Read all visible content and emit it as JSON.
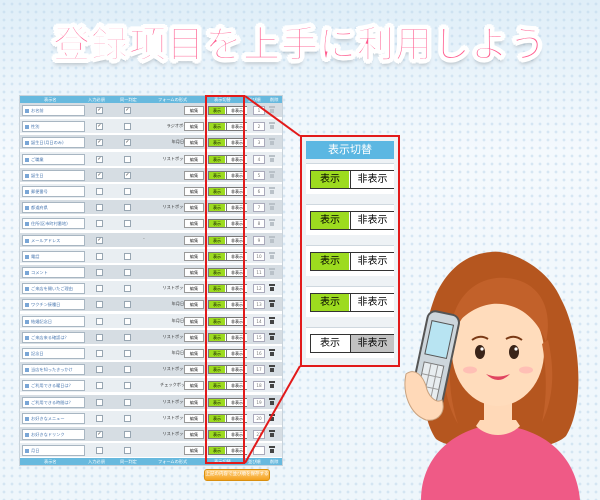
{
  "headline": "登録項目を上手に利用しよう",
  "table": {
    "header": [
      "表示名",
      "入力必須",
      "同一判定",
      "フォームの形式",
      "表示切替",
      "並び順",
      "削除"
    ],
    "footer": [
      "表示名",
      "入力必須",
      "同一判定",
      "フォームの形式",
      "表示切替",
      "並び順",
      "削除"
    ],
    "edit_label": "編集",
    "toggle_on": "表示",
    "toggle_off": "非表示",
    "rows": [
      {
        "name": "お名前",
        "required": true,
        "same": true,
        "type": "文字列",
        "visible": true,
        "order": "1",
        "trash": "light"
      },
      {
        "name": "性別",
        "required": true,
        "same": false,
        "type": "ラジオボタン選択",
        "visible": true,
        "order": "2",
        "trash": "light"
      },
      {
        "name": "誕生日(月日のみ)",
        "required": true,
        "same": true,
        "type": "年月日(誕生日)",
        "visible": true,
        "order": "3",
        "trash": "light"
      },
      {
        "name": "ご職業",
        "required": true,
        "same": false,
        "type": "リストボックス選択",
        "visible": true,
        "order": "4",
        "trash": "light"
      },
      {
        "name": "誕生日",
        "required": true,
        "same": true,
        "type": "文字列",
        "visible": true,
        "order": "5",
        "trash": "light"
      },
      {
        "name": "郵便番号",
        "required": false,
        "same": false,
        "type": "文字列",
        "visible": true,
        "order": "6",
        "trash": "light"
      },
      {
        "name": "都道府県",
        "required": false,
        "same": false,
        "type": "リストボックス選択",
        "visible": true,
        "order": "7",
        "trash": "light"
      },
      {
        "name": "住所(区市町村番地)",
        "required": false,
        "same": false,
        "type": "文字列",
        "visible": true,
        "order": "8",
        "trash": "light"
      },
      {
        "name": "メールアドレス",
        "required": true,
        "same": null,
        "type": "文字列",
        "visible": true,
        "order": "9",
        "trash": "light"
      },
      {
        "name": "電話",
        "required": false,
        "same": false,
        "type": "文字列",
        "visible": true,
        "order": "10",
        "trash": "light"
      },
      {
        "name": "コメント",
        "required": false,
        "same": false,
        "type": "文字列",
        "visible": true,
        "order": "11",
        "trash": "light"
      },
      {
        "name": "ご来店を開いたご理由",
        "required": false,
        "same": false,
        "type": "リストボックス選択",
        "visible": true,
        "order": "12",
        "trash": "dark"
      },
      {
        "name": "ワクチン接種日",
        "required": false,
        "same": false,
        "type": "年月日(誕生日)",
        "visible": true,
        "order": "13",
        "trash": "dark"
      },
      {
        "name": "結婚記念日",
        "required": false,
        "same": false,
        "type": "年月日(誕生日)",
        "visible": true,
        "order": "14",
        "trash": "dark"
      },
      {
        "name": "ご来店来る確認は？",
        "required": false,
        "same": false,
        "type": "リストボックス選択",
        "visible": true,
        "order": "15",
        "trash": "dark"
      },
      {
        "name": "記念日",
        "required": false,
        "same": false,
        "type": "年月日(誕生日)",
        "visible": true,
        "order": "16",
        "trash": "dark"
      },
      {
        "name": "当店を知ったきっかけ",
        "required": false,
        "same": false,
        "type": "リストボックス選択",
        "visible": true,
        "order": "17",
        "trash": "dark"
      },
      {
        "name": "ご利用できる曜日は？",
        "required": false,
        "same": false,
        "type": "チェックボックス選択",
        "visible": true,
        "order": "18",
        "trash": "dark"
      },
      {
        "name": "ご利用できる時間は？",
        "required": false,
        "same": false,
        "type": "リストボックス選択",
        "visible": true,
        "order": "19",
        "trash": "dark"
      },
      {
        "name": "お好きなメニュー",
        "required": false,
        "same": false,
        "type": "リストボックス選択",
        "visible": true,
        "order": "20",
        "trash": "dark"
      },
      {
        "name": "お好きなドリンク",
        "required": true,
        "same": false,
        "type": "リストボックス選択",
        "visible": true,
        "order": "21",
        "trash": "dark"
      },
      {
        "name": "月日",
        "required": false,
        "same": false,
        "type": "月日",
        "visible": true,
        "order": "",
        "trash": "dark"
      }
    ],
    "sort_button": "上記の内容で並び順を保存する"
  },
  "zoom": {
    "title": "表示切替",
    "on_label": "表示",
    "off_label": "非表示",
    "items": [
      {
        "visible": true
      },
      {
        "visible": true
      },
      {
        "visible": true
      },
      {
        "visible": true
      },
      {
        "visible": false
      }
    ]
  },
  "colors": {
    "headline": "#ff5b8e",
    "accent_blue": "#5cb7e2",
    "toggle_on": "#9ddb1f",
    "toggle_off": "#c2c2c2",
    "highlight": "#e21a1a"
  }
}
